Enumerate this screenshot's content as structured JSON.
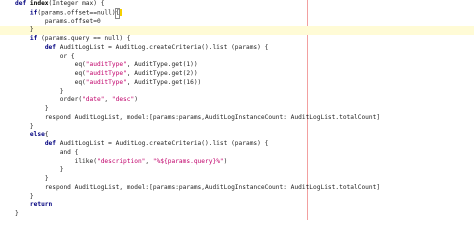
{
  "editor": {
    "lines": [
      {
        "indent": "",
        "parts": [
          {
            "c": "t-kw",
            "t": "def "
          },
          {
            "c": "t-bold",
            "t": "index"
          },
          {
            "c": "t-txt",
            "t": "(Integer max) {"
          }
        ]
      },
      {
        "indent": "    ",
        "parts": [
          {
            "c": "t-kw",
            "t": "if"
          },
          {
            "c": "t-txt",
            "t": "(params.offset==null)"
          },
          {
            "c": "t-txt",
            "t": "{"
          }
        ],
        "mark": true
      },
      {
        "indent": "        ",
        "parts": [
          {
            "c": "t-txt",
            "t": "params.offset=0"
          }
        ]
      },
      {
        "indent": "    ",
        "parts": [
          {
            "c": "t-txt",
            "t": "}"
          }
        ],
        "current": true
      },
      {
        "indent": "    ",
        "parts": [
          {
            "c": "t-kw",
            "t": "if"
          },
          {
            "c": "t-txt",
            "t": " (params.query == null) {"
          }
        ]
      },
      {
        "indent": "        ",
        "parts": [
          {
            "c": "t-kw",
            "t": "def "
          },
          {
            "c": "t-txt",
            "t": "AuditLogList = AuditLog.createCriteria().list (params) {"
          }
        ]
      },
      {
        "indent": "            ",
        "parts": [
          {
            "c": "t-txt",
            "t": "or {"
          }
        ]
      },
      {
        "indent": "                ",
        "parts": [
          {
            "c": "t-txt",
            "t": "eq("
          },
          {
            "c": "t-str",
            "t": "\"auditType\""
          },
          {
            "c": "t-txt",
            "t": ", AuditType.get(1))"
          }
        ]
      },
      {
        "indent": "                ",
        "parts": [
          {
            "c": "t-txt",
            "t": "eq("
          },
          {
            "c": "t-str",
            "t": "\"auditType\""
          },
          {
            "c": "t-txt",
            "t": ", AuditType.get(2))"
          }
        ]
      },
      {
        "indent": "                ",
        "parts": [
          {
            "c": "t-txt",
            "t": "eq("
          },
          {
            "c": "t-str",
            "t": "\"auditType\""
          },
          {
            "c": "t-txt",
            "t": ", AuditType.get(16))"
          }
        ]
      },
      {
        "indent": "            ",
        "parts": [
          {
            "c": "t-txt",
            "t": "}"
          }
        ]
      },
      {
        "indent": "            ",
        "parts": [
          {
            "c": "t-txt",
            "t": "order("
          },
          {
            "c": "t-str",
            "t": "\"date\""
          },
          {
            "c": "t-txt",
            "t": ", "
          },
          {
            "c": "t-str",
            "t": "\"desc\""
          },
          {
            "c": "t-txt",
            "t": ")"
          }
        ]
      },
      {
        "indent": "        ",
        "parts": [
          {
            "c": "t-txt",
            "t": "}"
          }
        ]
      },
      {
        "indent": "        ",
        "parts": [
          {
            "c": "t-txt",
            "t": "respond AuditLogList, model:[params:params,AuditLogInstanceCount: AuditLogList.totalCount]"
          }
        ]
      },
      {
        "indent": "    ",
        "parts": [
          {
            "c": "t-txt",
            "t": "}"
          }
        ]
      },
      {
        "indent": "    ",
        "parts": [
          {
            "c": "t-kw",
            "t": "else"
          },
          {
            "c": "t-txt",
            "t": "{"
          }
        ]
      },
      {
        "indent": "        ",
        "parts": [
          {
            "c": "t-kw",
            "t": "def "
          },
          {
            "c": "t-txt",
            "t": "AuditLogList = AuditLog.createCriteria().list (params) {"
          }
        ]
      },
      {
        "indent": "            ",
        "parts": [
          {
            "c": "t-txt",
            "t": "and {"
          }
        ]
      },
      {
        "indent": "                ",
        "parts": [
          {
            "c": "t-txt",
            "t": "ilike("
          },
          {
            "c": "t-str",
            "t": "\"description\""
          },
          {
            "c": "t-txt",
            "t": ", "
          },
          {
            "c": "t-str",
            "t": "\"%${params.query}%\""
          },
          {
            "c": "t-txt",
            "t": ")"
          }
        ]
      },
      {
        "indent": "            ",
        "parts": [
          {
            "c": "t-txt",
            "t": "}"
          }
        ]
      },
      {
        "indent": "        ",
        "parts": [
          {
            "c": "t-txt",
            "t": "}"
          }
        ]
      },
      {
        "indent": "        ",
        "parts": [
          {
            "c": "t-txt",
            "t": "respond AuditLogList, model:[params:params,AuditLogInstanceCount: AuditLogList.totalCount]"
          }
        ]
      },
      {
        "indent": "    ",
        "parts": [
          {
            "c": "t-txt",
            "t": "}"
          }
        ]
      },
      {
        "indent": "    ",
        "parts": [
          {
            "c": "t-kw",
            "t": "return"
          }
        ]
      },
      {
        "indent": "",
        "parts": [
          {
            "c": "t-txt",
            "t": "}"
          }
        ]
      }
    ]
  }
}
